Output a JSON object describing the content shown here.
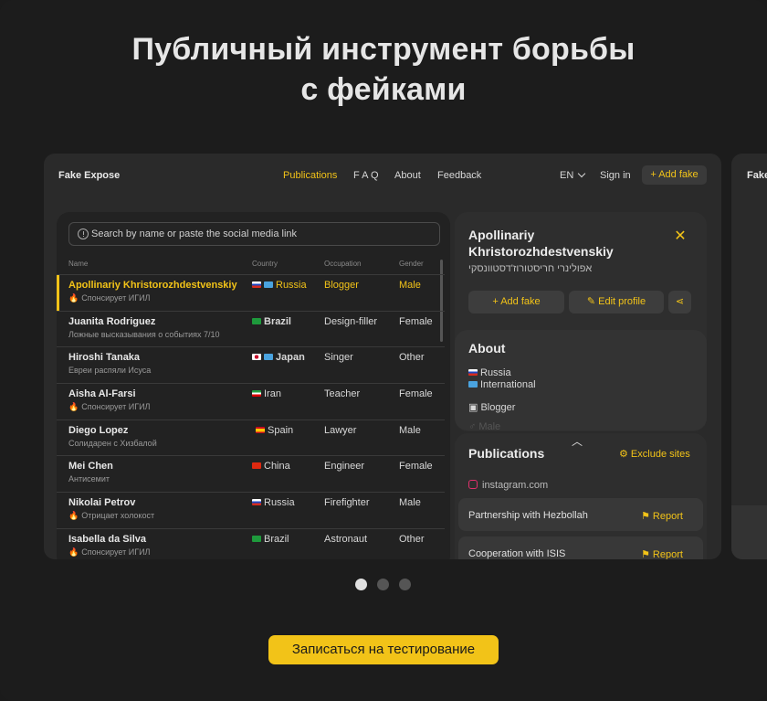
{
  "hero": {
    "line1": "Публичный инструмент борьбы",
    "line2": "с фейками"
  },
  "nav": {
    "logo": "Fake Expose",
    "links": [
      "Publications",
      "F A Q",
      "About",
      "Feedback"
    ],
    "lang": "EN",
    "signin": "Sign in",
    "add_fake": "+ Add fake"
  },
  "peek": {
    "logo": "Fake"
  },
  "search": {
    "placeholder": "Search by name or paste the social media link"
  },
  "table": {
    "headers": [
      "Name",
      "Country",
      "Occupation",
      "Gender"
    ],
    "rows": [
      {
        "name": "Apollinariy Khristorozhdestvenskiy",
        "sub": "Спонсирует ИГИЛ",
        "flame": true,
        "country": "Russia",
        "occupation": "Blogger",
        "gender": "Male"
      },
      {
        "name": "Juanita Rodriguez",
        "sub": "Ложные высказывания о событиях 7/10",
        "flame": false,
        "country": "Brazil",
        "occupation": "Design-filler",
        "gender": "Female"
      },
      {
        "name": "Hiroshi Tanaka",
        "sub": "Евреи распяли Исуса",
        "flame": false,
        "country": "Japan",
        "occupation": "Singer",
        "gender": "Other"
      },
      {
        "name": "Aisha Al-Farsi",
        "sub": "Спонсирует ИГИЛ",
        "flame": true,
        "country": "Iran",
        "occupation": "Teacher",
        "gender": "Female"
      },
      {
        "name": "Diego Lopez",
        "sub": "Солидарен с Хизбалой",
        "flame": false,
        "country": "Spain",
        "occupation": "Lawyer",
        "gender": "Male"
      },
      {
        "name": "Mei Chen",
        "sub": "Антисемит",
        "flame": false,
        "country": "China",
        "occupation": "Engineer",
        "gender": "Female"
      },
      {
        "name": "Nikolai Petrov",
        "sub": "Отрицает холокост",
        "flame": true,
        "country": "Russia",
        "occupation": "Firefighter",
        "gender": "Male"
      },
      {
        "name": "Isabella da Silva",
        "sub": "Спонсирует ИГИЛ",
        "flame": true,
        "country": "Brazil",
        "occupation": "Astronaut",
        "gender": "Other"
      }
    ]
  },
  "profile": {
    "name": "Apollinariy Khristorozhdestvenskiy",
    "alt_name": "אפולינרי חריסטורוז'דסטוונסקי",
    "add_fake": "Add fake",
    "edit_profile": "Edit profile"
  },
  "about": {
    "title": "About",
    "country": "Russia",
    "region": "International",
    "occupation": "Blogger",
    "gender": "Male"
  },
  "publications": {
    "title": "Publications",
    "exclude": "Exclude sites",
    "site": "instagram.com",
    "items": [
      {
        "title": "Partnership with Hezbollah",
        "report": "Report"
      },
      {
        "title": "Cooperation with ISIS",
        "report": "Report"
      }
    ]
  },
  "carousel": {
    "count": 3,
    "active": 0
  },
  "cta": {
    "label": "Записаться на тестирование"
  },
  "colors": {
    "accent": "#f2c318",
    "background": "#1c1c1c",
    "panel": "#2a2a2a"
  }
}
